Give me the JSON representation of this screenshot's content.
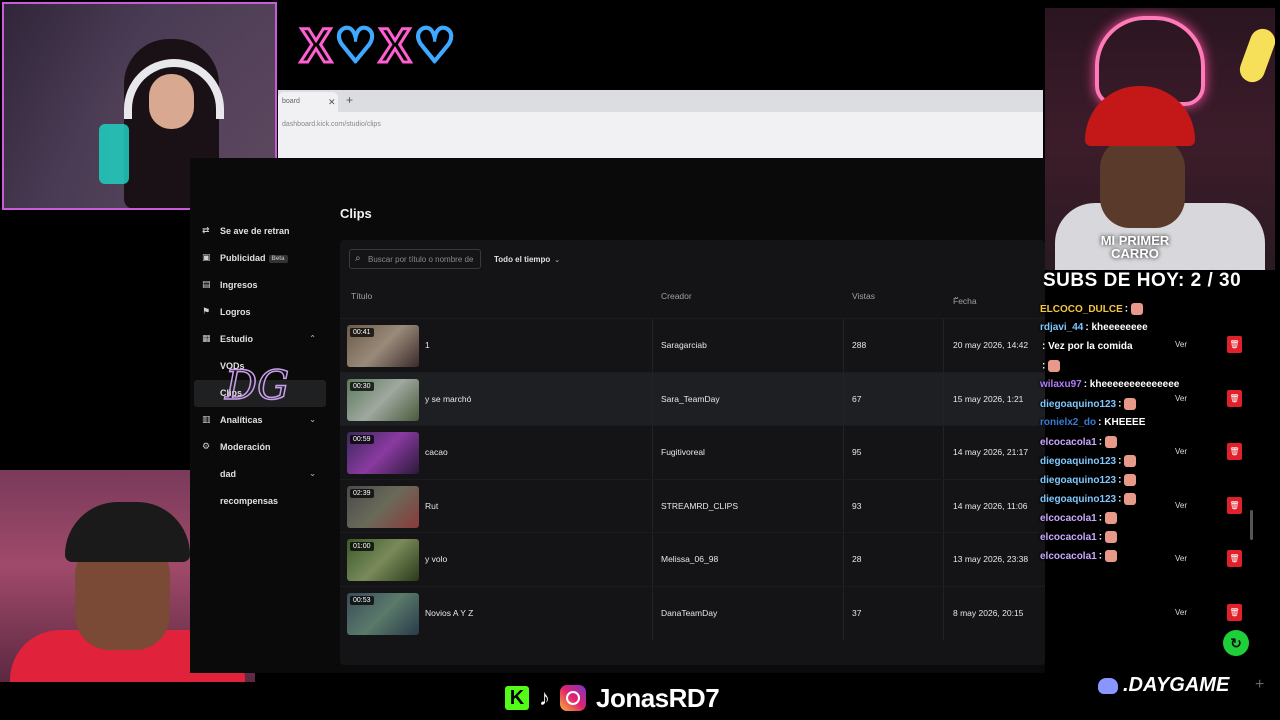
{
  "overlay": {
    "xoxo": [
      "X",
      "♡",
      "X",
      "♡"
    ],
    "subs": "SUBS DE HOY: 2 / 30",
    "cam_badge": "MI PRIMER\nCARRO",
    "handle": "JonasRD7",
    "discord": ".DAYGAME",
    "kick_icon": "K",
    "tiktok_icon": "♪"
  },
  "browser": {
    "tab_title": "board",
    "url": "dashboard.kick.com/studio/clips"
  },
  "sidebar": {
    "items": [
      {
        "label": "Se       ave de retran",
        "icon": "⇄"
      },
      {
        "label": "Publicidad",
        "icon": "▣",
        "badge": "Beta"
      },
      {
        "label": "Ingresos",
        "icon": "▤"
      },
      {
        "label": "Logros",
        "icon": "⚑"
      },
      {
        "label": "Estudio",
        "icon": "▦",
        "chev": "^"
      },
      {
        "label": "VODs",
        "sub": true
      },
      {
        "label": "Clips",
        "sub": true,
        "active": true
      },
      {
        "label": "Analíticas",
        "icon": "▥",
        "chev": "v"
      },
      {
        "label": "Moderación",
        "icon": "⚙"
      },
      {
        "label": "dad",
        "chev": "v"
      },
      {
        "label": "recompensas"
      }
    ]
  },
  "page": {
    "title": "Clips",
    "search_placeholder": "Buscar por título o nombre de",
    "filter": "Todo el tiempo",
    "columns": [
      "Título",
      "Creador",
      "Vistas",
      "Fecha"
    ]
  },
  "clips": [
    {
      "duration": "00:41",
      "title": "1",
      "creator": "Saragarciab",
      "views": "288",
      "date": "20 may 2026, 14:42"
    },
    {
      "duration": "00:30",
      "title": "y se marchó",
      "creator": "Sara_TeamDay",
      "views": "67",
      "date": "15 may 2026, 1:21"
    },
    {
      "duration": "00:59",
      "title": "cacao",
      "creator": "Fugitivoreal",
      "views": "95",
      "date": "14 may 2026, 21:17"
    },
    {
      "duration": "02:39",
      "title": "Rut",
      "creator": "STREAMRD_CLIPS",
      "views": "93",
      "date": "14 may 2026, 11:06"
    },
    {
      "duration": "01:00",
      "title": "y volo",
      "creator": "Melissa_06_98",
      "views": "28",
      "date": "13 may 2026, 23:38"
    },
    {
      "duration": "00:53",
      "title": "Novios A Y Z",
      "creator": "DanaTeamDay",
      "views": "37",
      "date": "8 may 2026, 20:15"
    }
  ],
  "row_action": "Ver",
  "chat": [
    {
      "user": "ELCOCO_DULCE",
      "msg": ":",
      "color": "#f5c542",
      "emote": true
    },
    {
      "user": "rdjavi_44",
      "msg": ": kheeeeeeee",
      "color": "#7ec8ff"
    },
    {
      "user": "          ",
      "msg": ": Vez por la comida",
      "color": "#ff3b3b"
    },
    {
      "user": "       ",
      "msg": ":",
      "color": "#ff3b3b",
      "emote": true
    },
    {
      "user": "wilaxu97",
      "msg": ": kheeeeeeeeeeeeee",
      "color": "#b07cff"
    },
    {
      "user": "diegoaquino123",
      "msg": ":",
      "color": "#7ec8ff",
      "emote": true
    },
    {
      "user": "ronielx2_do",
      "msg": ": KHEEEE",
      "color": "#3a7bd5"
    },
    {
      "user": "elcocacola1",
      "msg": ":",
      "color": "#c8a8ff",
      "emote": true
    },
    {
      "user": "diegoaquino123",
      "msg": ":",
      "color": "#7ec8ff",
      "emote": true
    },
    {
      "user": "diegoaquino123",
      "msg": ":",
      "color": "#7ec8ff",
      "emote": true
    },
    {
      "user": "diegoaquino123",
      "msg": ":",
      "color": "#7ec8ff",
      "emote": true
    },
    {
      "user": "elcocacola1",
      "msg": ":",
      "color": "#c8a8ff",
      "emote": true
    },
    {
      "user": "elcocacola1",
      "msg": ":",
      "color": "#c8a8ff",
      "emote": true
    },
    {
      "user": "elcocacola1",
      "msg": ":",
      "color": "#c8a8ff",
      "emote": true
    }
  ],
  "colors": {
    "accent": "#53fc18",
    "delete": "#e0202a",
    "pink": "#ff5fd0",
    "blue": "#3fa8ff"
  }
}
